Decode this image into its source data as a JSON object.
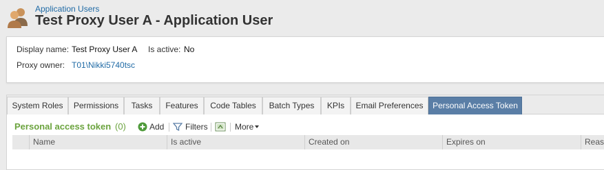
{
  "header": {
    "breadcrumb": "Application Users",
    "title": "Test Proxy User A - Application User"
  },
  "details": {
    "display_name_label": "Display name:",
    "display_name_value": "Test Proxy User A",
    "is_active_label": "Is active:",
    "is_active_value": "No",
    "proxy_owner_label": "Proxy owner:",
    "proxy_owner_value": "T01\\Nikki5740tsc"
  },
  "tabs": [
    {
      "label": "System Roles",
      "active": false
    },
    {
      "label": "Permissions",
      "active": false
    },
    {
      "label": "Tasks",
      "active": false
    },
    {
      "label": "Features",
      "active": false
    },
    {
      "label": "Code Tables",
      "active": false
    },
    {
      "label": "Batch Types",
      "active": false
    },
    {
      "label": "KPIs",
      "active": false
    },
    {
      "label": "Email Preferences",
      "active": false
    },
    {
      "label": "Personal Access Token",
      "active": true
    }
  ],
  "section": {
    "title": "Personal access token",
    "count": "(0)"
  },
  "toolbar": {
    "add_label": "Add",
    "filters_label": "Filters",
    "more_label": "More"
  },
  "grid": {
    "columns": [
      "Name",
      "Is active",
      "Created on",
      "Expires on",
      "Reason"
    ]
  },
  "colors": {
    "accent_link": "#1f6aa5",
    "section_green": "#6ba33e",
    "active_tab": "#5a7ea6"
  }
}
